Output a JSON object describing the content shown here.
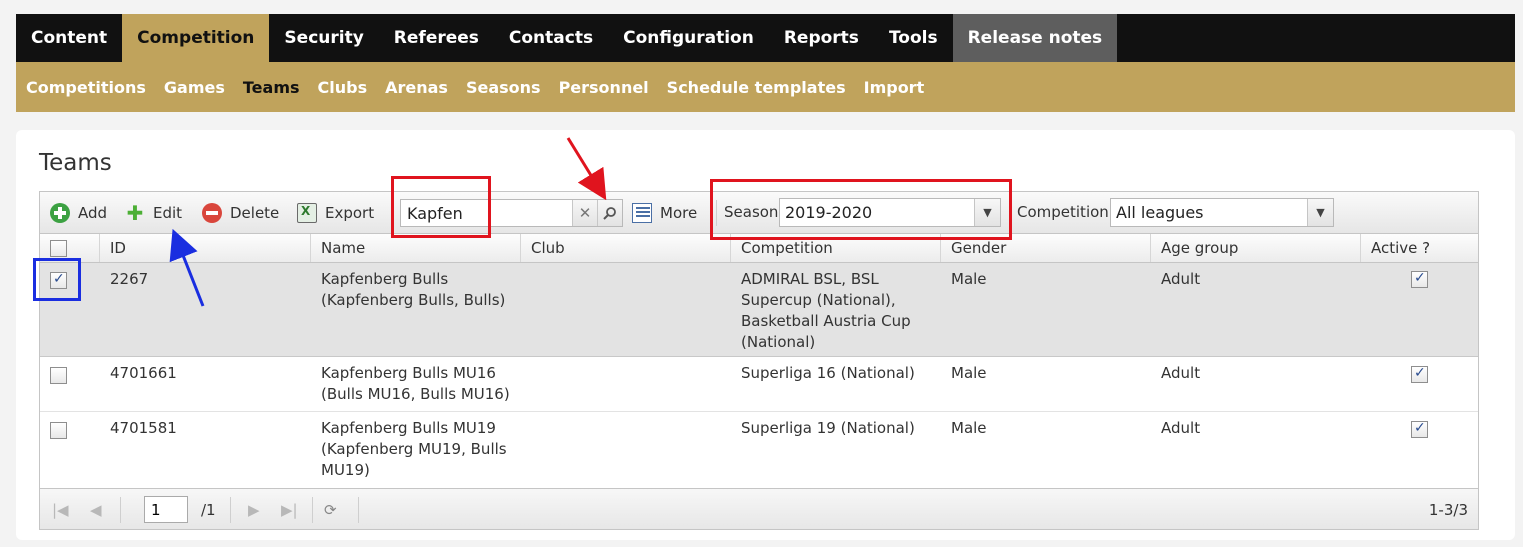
{
  "topnav": {
    "items": [
      {
        "label": "Content"
      },
      {
        "label": "Competition"
      },
      {
        "label": "Security"
      },
      {
        "label": "Referees"
      },
      {
        "label": "Contacts"
      },
      {
        "label": "Configuration"
      },
      {
        "label": "Reports"
      },
      {
        "label": "Tools"
      },
      {
        "label": "Release notes"
      }
    ],
    "active": "Competition"
  },
  "subnav": {
    "items": [
      {
        "label": "Competitions"
      },
      {
        "label": "Games"
      },
      {
        "label": "Teams"
      },
      {
        "label": "Clubs"
      },
      {
        "label": "Arenas"
      },
      {
        "label": "Seasons"
      },
      {
        "label": "Personnel"
      },
      {
        "label": "Schedule templates"
      },
      {
        "label": "Import"
      }
    ],
    "active": "Teams"
  },
  "page": {
    "title": "Teams"
  },
  "toolbar": {
    "add_label": "Add",
    "edit_label": "Edit",
    "delete_label": "Delete",
    "export_label": "Export",
    "search_value": "Kapfen",
    "more_label": "More",
    "season_label": "Season",
    "season_value": "2019-2020",
    "competition_label": "Competition",
    "competition_value": "All leagues"
  },
  "table": {
    "columns": [
      "ID",
      "Name",
      "Club",
      "Competition",
      "Gender",
      "Age group",
      "Active ?"
    ],
    "rows": [
      {
        "checked": true,
        "id": "2267",
        "name_lines": [
          "Kapfenberg Bulls",
          "(Kapfenberg Bulls, Bulls)"
        ],
        "club": "",
        "competition_lines": [
          "ADMIRAL BSL, BSL",
          "Supercup (National),",
          "Basketball Austria Cup",
          "(National)"
        ],
        "gender": "Male",
        "age_group": "Adult",
        "active": true
      },
      {
        "checked": false,
        "id": "4701661",
        "name_lines": [
          "Kapfenberg Bulls MU16",
          "(Bulls MU16, Bulls MU16)"
        ],
        "club": "",
        "competition_lines": [
          "Superliga 16 (National)"
        ],
        "gender": "Male",
        "age_group": "Adult",
        "active": true
      },
      {
        "checked": false,
        "id": "4701581",
        "name_lines": [
          "Kapfenberg Bulls MU19",
          "(Kapfenberg MU19, Bulls",
          "MU19)"
        ],
        "club": "",
        "competition_lines": [
          "Superliga 19 (National)"
        ],
        "gender": "Male",
        "age_group": "Adult",
        "active": true
      }
    ]
  },
  "pager": {
    "page_value": "1",
    "total_pages": "/1",
    "info": "1-3/3"
  },
  "icons": {
    "add": "add-icon",
    "edit": "puzzle-icon",
    "delete": "delete-icon",
    "export": "excel-icon",
    "clear": "close-icon",
    "search": "search-icon",
    "more": "list-icon",
    "dropdown": "chevron-down-icon",
    "refresh": "refresh-icon"
  },
  "colors": {
    "nav_bg": "#111111",
    "accent_gold": "#c0a35c",
    "annotation_red": "#e0141e",
    "annotation_blue": "#1a2ee0"
  }
}
